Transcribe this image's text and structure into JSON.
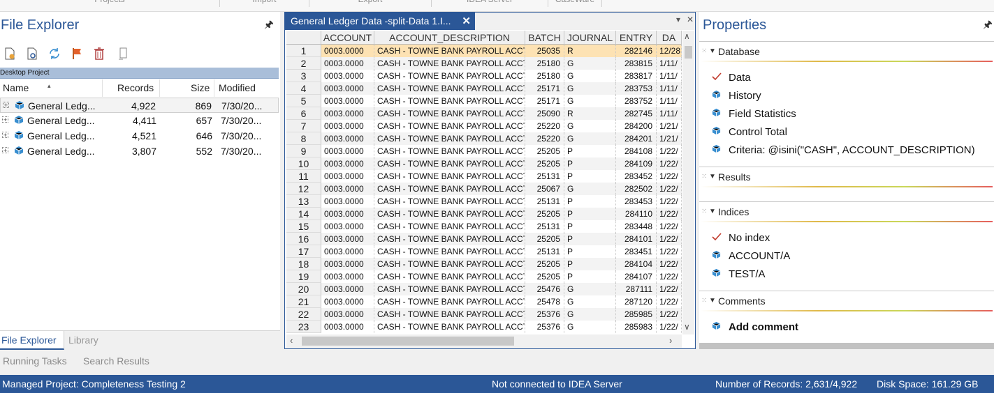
{
  "ribbon": {
    "groups": [
      "Projects",
      "Import",
      "Export",
      "IDEA Server",
      "CaseWare"
    ]
  },
  "file_explorer": {
    "title": "File Explorer",
    "project_label": "Desktop Project",
    "columns": {
      "name": "Name",
      "records": "Records",
      "size": "Size",
      "modified": "Modified"
    },
    "rows": [
      {
        "name": "General Ledg...",
        "records": "4,922",
        "size": "869",
        "modified": "7/30/20..."
      },
      {
        "name": "General Ledg...",
        "records": "4,411",
        "size": "657",
        "modified": "7/30/20..."
      },
      {
        "name": "General Ledg...",
        "records": "4,521",
        "size": "646",
        "modified": "7/30/20..."
      },
      {
        "name": "General Ledg...",
        "records": "3,807",
        "size": "552",
        "modified": "7/30/20..."
      }
    ],
    "tabs": {
      "active": "File Explorer",
      "other": "Library"
    },
    "lower_tabs": {
      "running": "Running Tasks",
      "search": "Search Results"
    }
  },
  "grid": {
    "tab_title": "General Ledger Data -split-Data 1.I...",
    "columns": [
      "ACCOUNT",
      "ACCOUNT_DESCRIPTION",
      "BATCH",
      "JOURNAL",
      "ENTRY",
      "DA"
    ],
    "rows": [
      {
        "n": "1",
        "account": "0003.0000",
        "desc": "CASH - TOWNE BANK PAYROLL ACCT",
        "batch": "25035",
        "journal": "R",
        "entry": "282146",
        "date": "12/28"
      },
      {
        "n": "2",
        "account": "0003.0000",
        "desc": "CASH - TOWNE BANK PAYROLL ACCT",
        "batch": "25180",
        "journal": "G",
        "entry": "283815",
        "date": "1/11/"
      },
      {
        "n": "3",
        "account": "0003.0000",
        "desc": "CASH - TOWNE BANK PAYROLL ACCT",
        "batch": "25180",
        "journal": "G",
        "entry": "283817",
        "date": "1/11/"
      },
      {
        "n": "4",
        "account": "0003.0000",
        "desc": "CASH - TOWNE BANK PAYROLL ACCT",
        "batch": "25171",
        "journal": "G",
        "entry": "283753",
        "date": "1/11/"
      },
      {
        "n": "5",
        "account": "0003.0000",
        "desc": "CASH - TOWNE BANK PAYROLL ACCT",
        "batch": "25171",
        "journal": "G",
        "entry": "283752",
        "date": "1/11/"
      },
      {
        "n": "6",
        "account": "0003.0000",
        "desc": "CASH - TOWNE BANK PAYROLL ACCT",
        "batch": "25090",
        "journal": "R",
        "entry": "282745",
        "date": "1/11/"
      },
      {
        "n": "7",
        "account": "0003.0000",
        "desc": "CASH - TOWNE BANK PAYROLL ACCT",
        "batch": "25220",
        "journal": "G",
        "entry": "284200",
        "date": "1/21/"
      },
      {
        "n": "8",
        "account": "0003.0000",
        "desc": "CASH - TOWNE BANK PAYROLL ACCT",
        "batch": "25220",
        "journal": "G",
        "entry": "284201",
        "date": "1/21/"
      },
      {
        "n": "9",
        "account": "0003.0000",
        "desc": "CASH - TOWNE BANK PAYROLL ACCT",
        "batch": "25205",
        "journal": "P",
        "entry": "284108",
        "date": "1/22/"
      },
      {
        "n": "10",
        "account": "0003.0000",
        "desc": "CASH - TOWNE BANK PAYROLL ACCT",
        "batch": "25205",
        "journal": "P",
        "entry": "284109",
        "date": "1/22/"
      },
      {
        "n": "11",
        "account": "0003.0000",
        "desc": "CASH - TOWNE BANK PAYROLL ACCT",
        "batch": "25131",
        "journal": "P",
        "entry": "283452",
        "date": "1/22/"
      },
      {
        "n": "12",
        "account": "0003.0000",
        "desc": "CASH - TOWNE BANK PAYROLL ACCT",
        "batch": "25067",
        "journal": "G",
        "entry": "282502",
        "date": "1/22/"
      },
      {
        "n": "13",
        "account": "0003.0000",
        "desc": "CASH - TOWNE BANK PAYROLL ACCT",
        "batch": "25131",
        "journal": "P",
        "entry": "283453",
        "date": "1/22/"
      },
      {
        "n": "14",
        "account": "0003.0000",
        "desc": "CASH - TOWNE BANK PAYROLL ACCT",
        "batch": "25205",
        "journal": "P",
        "entry": "284110",
        "date": "1/22/"
      },
      {
        "n": "15",
        "account": "0003.0000",
        "desc": "CASH - TOWNE BANK PAYROLL ACCT",
        "batch": "25131",
        "journal": "P",
        "entry": "283448",
        "date": "1/22/"
      },
      {
        "n": "16",
        "account": "0003.0000",
        "desc": "CASH - TOWNE BANK PAYROLL ACCT",
        "batch": "25205",
        "journal": "P",
        "entry": "284101",
        "date": "1/22/"
      },
      {
        "n": "17",
        "account": "0003.0000",
        "desc": "CASH - TOWNE BANK PAYROLL ACCT",
        "batch": "25131",
        "journal": "P",
        "entry": "283451",
        "date": "1/22/"
      },
      {
        "n": "18",
        "account": "0003.0000",
        "desc": "CASH - TOWNE BANK PAYROLL ACCT",
        "batch": "25205",
        "journal": "P",
        "entry": "284104",
        "date": "1/22/"
      },
      {
        "n": "19",
        "account": "0003.0000",
        "desc": "CASH - TOWNE BANK PAYROLL ACCT",
        "batch": "25205",
        "journal": "P",
        "entry": "284107",
        "date": "1/22/"
      },
      {
        "n": "20",
        "account": "0003.0000",
        "desc": "CASH - TOWNE BANK PAYROLL ACCT",
        "batch": "25476",
        "journal": "G",
        "entry": "287111",
        "date": "1/22/"
      },
      {
        "n": "21",
        "account": "0003.0000",
        "desc": "CASH - TOWNE BANK PAYROLL ACCT",
        "batch": "25478",
        "journal": "G",
        "entry": "287120",
        "date": "1/22/"
      },
      {
        "n": "22",
        "account": "0003.0000",
        "desc": "CASH - TOWNE BANK PAYROLL ACCT",
        "batch": "25376",
        "journal": "G",
        "entry": "285985",
        "date": "1/22/"
      },
      {
        "n": "23",
        "account": "0003.0000",
        "desc": "CASH - TOWNE BANK PAYROLL ACCT",
        "batch": "25376",
        "journal": "G",
        "entry": "285983",
        "date": "1/22/"
      }
    ]
  },
  "properties": {
    "title": "Properties",
    "sections": {
      "database": {
        "label": "Database",
        "items": [
          {
            "icon": "check-icon",
            "label": "Data"
          },
          {
            "icon": "cube-icon",
            "label": "History"
          },
          {
            "icon": "cube-icon",
            "label": "Field Statistics"
          },
          {
            "icon": "cube-icon",
            "label": "Control Total"
          },
          {
            "icon": "cube-icon",
            "label": "Criteria: @isini(\"CASH\", ACCOUNT_DESCRIPTION)"
          }
        ]
      },
      "results": {
        "label": "Results"
      },
      "indices": {
        "label": "Indices",
        "items": [
          {
            "icon": "check-icon",
            "label": "No index"
          },
          {
            "icon": "cube-icon",
            "label": "ACCOUNT/A"
          },
          {
            "icon": "cube-icon",
            "label": "TEST/A"
          }
        ]
      },
      "comments": {
        "label": "Comments",
        "items": [
          {
            "icon": "cube-icon",
            "label": "Add comment"
          }
        ]
      }
    }
  },
  "status": {
    "project": "Managed Project: Completeness Testing 2",
    "server": "Not connected to IDEA Server",
    "records": "Number of Records: 2,631/4,922",
    "disk": "Disk Space: 161.29 GB"
  },
  "colors": {
    "accent": "#2b5797",
    "selected_row": "#fde2b3",
    "check": "#c0392b",
    "cube": "#3a8fd0"
  }
}
